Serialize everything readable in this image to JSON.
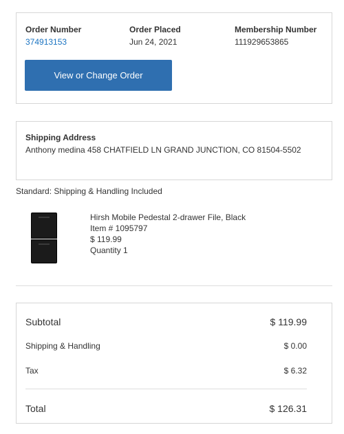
{
  "order": {
    "number_label": "Order Number",
    "number_value": "374913153",
    "placed_label": "Order Placed",
    "placed_value": "Jun 24, 2021",
    "membership_label": "Membership Number",
    "membership_value": "111929653865",
    "button_label": "View or Change Order"
  },
  "shipping": {
    "heading": "Shipping Address",
    "address": "Anthony medina  458 CHATFIELD LN  GRAND JUNCTION, CO 81504-5502",
    "method": "Standard: Shipping & Handling Included"
  },
  "item": {
    "name": "Hirsh Mobile Pedestal 2-drawer File, Black",
    "item_number": "Item # 1095797",
    "price": "$ 119.99",
    "quantity": "Quantity 1",
    "image_icon": "file-cabinet-image"
  },
  "totals": {
    "subtotal_label": "Subtotal",
    "subtotal_value": "$ 119.99",
    "shipping_label": "Shipping & Handling",
    "shipping_value": "$ 0.00",
    "tax_label": "Tax",
    "tax_value": "$ 6.32",
    "total_label": "Total",
    "total_value": "$ 126.31"
  },
  "colors": {
    "link": "#1a73c1",
    "button": "#2f6fb0",
    "border": "#d6d6d6"
  }
}
